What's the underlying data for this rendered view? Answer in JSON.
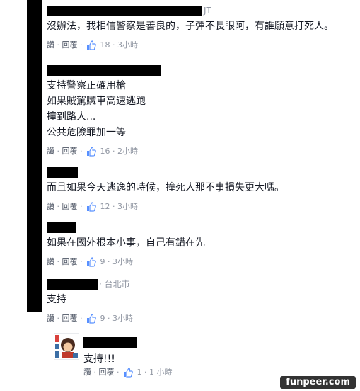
{
  "comments": [
    {
      "name_tail": "JT",
      "text": [
        "沒辦法，我相信警察是善良的，子彈不長眼阿，有誰願意打死人。"
      ],
      "read": "讚",
      "reply": "回覆",
      "likes": "18",
      "time": "3小時"
    },
    {
      "text": [
        "支持警察正確用槍",
        "如果賊駕贓車高速逃跑",
        "撞到路人...",
        "公共危險罪加一等"
      ],
      "read": "讚",
      "reply": "回覆",
      "likes": "16",
      "time": "2小時"
    },
    {
      "text": [
        "而且如果今天逃逸的時候，撞死人那不事損失更大嗎。"
      ],
      "read": "讚",
      "reply": "回覆",
      "likes": "12",
      "time": "3小時"
    },
    {
      "text": [
        "如果在國外根本小事，自己有錯在先"
      ],
      "read": "讚",
      "reply": "回覆",
      "likes": "9",
      "time": "3小時"
    },
    {
      "name_tail": "· 台北市",
      "text": [
        "支持"
      ],
      "read": "讚",
      "reply": "回覆",
      "likes": "9",
      "time": "3小時"
    }
  ],
  "reply": {
    "text": "支持!!!",
    "read": "讚",
    "reply": "回覆",
    "likes": "1",
    "time": "1 小時"
  },
  "watermark": "funpeer.com",
  "colors": {
    "link": "#4e5665",
    "meta": "#9197a3",
    "text": "#141823",
    "like_blue": "#5890ff"
  }
}
